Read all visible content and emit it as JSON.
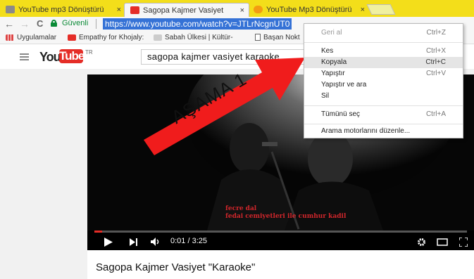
{
  "tabs": [
    {
      "title": "YouTube mp3 Dönüştürü",
      "close": "×",
      "icon": "converter-icon",
      "active": false
    },
    {
      "title": "Sagopa Kajmer Vasiyet",
      "close": "×",
      "icon": "youtube-icon",
      "active": true
    },
    {
      "title": "YouTube Mp3 Dönüştürü",
      "close": "×",
      "icon": "converter-icon",
      "active": false
    }
  ],
  "address": {
    "back": "←",
    "forward": "→",
    "reload": "C",
    "secure_label": "Güvenli",
    "url": "https://www.youtube.com/watch?v=JTLrNcgnUT0"
  },
  "bookmarks": [
    {
      "label": "Uygulamalar",
      "icon": "apps-icon"
    },
    {
      "label": "Empathy for Khojaly:",
      "icon": "youtube-icon"
    },
    {
      "label": "Sabah Ülkesi | Kültür-",
      "icon": "site-icon"
    },
    {
      "label": "Başan Nokt",
      "icon": "page-icon"
    }
  ],
  "youtube": {
    "logo_you": "You",
    "logo_tube": "Tube",
    "region": "TR",
    "search_value": "sagopa kajmer vasiyet karaoke"
  },
  "video": {
    "time": "0:01 / 3:25",
    "progress_fraction": 0.005,
    "lyrics_line1": "fecre dal",
    "lyrics_line2": "fedai cemiyetleri ile cumhur kadil",
    "title": "Sagopa Kajmer Vasiyet \"Karaoke\""
  },
  "context_menu": {
    "items": [
      {
        "label": "Geri al",
        "shortcut": "Ctrl+Z",
        "disabled": true,
        "highlighted": false
      },
      {
        "label": "Kes",
        "shortcut": "Ctrl+X",
        "disabled": false,
        "highlighted": false
      },
      {
        "label": "Kopyala",
        "shortcut": "Ctrl+C",
        "disabled": false,
        "highlighted": true
      },
      {
        "label": "Yapıştır",
        "shortcut": "Ctrl+V",
        "disabled": false,
        "highlighted": false
      },
      {
        "label": "Yapıştır ve ara",
        "shortcut": "",
        "disabled": false,
        "highlighted": false
      },
      {
        "label": "Sil",
        "shortcut": "",
        "disabled": false,
        "highlighted": false
      },
      {
        "label": "Tümünü seç",
        "shortcut": "Ctrl+A",
        "disabled": false,
        "highlighted": false
      },
      {
        "label": "Arama motorlarını düzenle...",
        "shortcut": "",
        "disabled": false,
        "highlighted": false
      }
    ]
  },
  "annotation": {
    "step_label": "AŞAMA 1",
    "arrow_color": "#f01c1c"
  }
}
